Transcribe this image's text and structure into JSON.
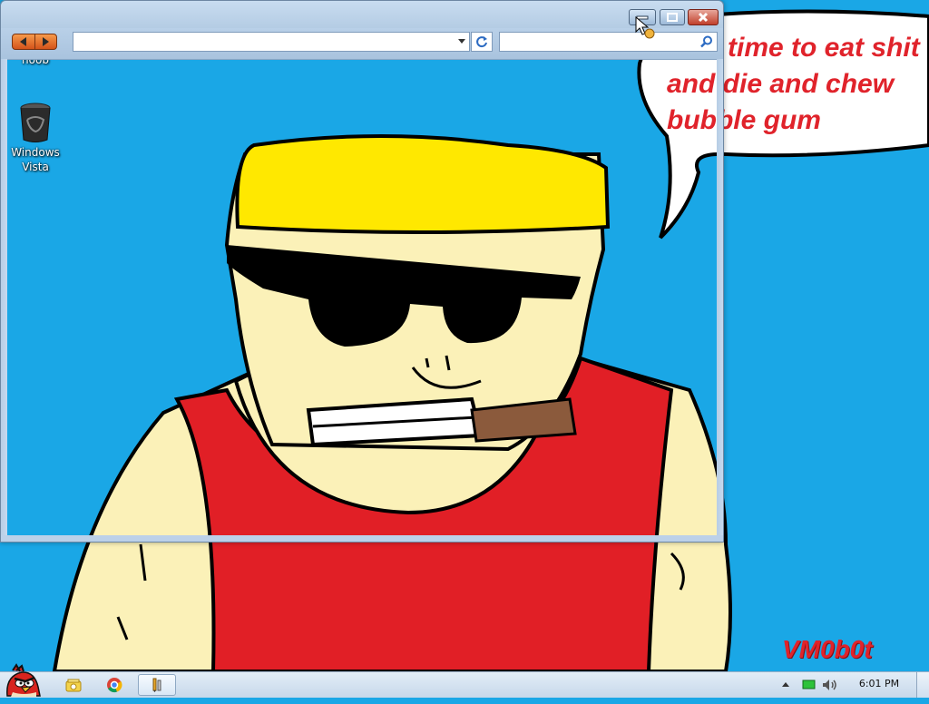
{
  "desktop": {
    "icons": [
      {
        "label": "noob",
        "icon": "folder-icon"
      },
      {
        "label": "Windows Vista",
        "icon": "recycle-bin-icon"
      }
    ],
    "wallpaper": {
      "speech_lines": [
        "time to eat shit",
        "and die and chew",
        "bubble gum"
      ],
      "signature": "VM0b0t",
      "colors": {
        "sky": "#1aa7e6",
        "skin": "#fbf1b8",
        "hair": "#ffe800",
        "shirt": "#e11f26",
        "text": "#e0232b",
        "cigar": "#8b5a3c"
      }
    }
  },
  "browser": {
    "address_value": "",
    "search_placeholder": "",
    "icons": {
      "back": "back-arrow-icon",
      "forward": "forward-arrow-icon",
      "refresh": "refresh-icon",
      "search": "search-icon",
      "dropdown": "chevron-down-icon",
      "minimize": "minimize-icon",
      "maximize": "maximize-icon",
      "close": "close-icon"
    }
  },
  "taskbar": {
    "clock": "6:01 PM",
    "pinned": [
      "angry-bird-start-icon",
      "explorer-icon",
      "chrome-icon",
      "paint-icon"
    ],
    "tray_icons": [
      "show-hidden-icons-arrow",
      "network-icon",
      "volume-icon"
    ]
  }
}
